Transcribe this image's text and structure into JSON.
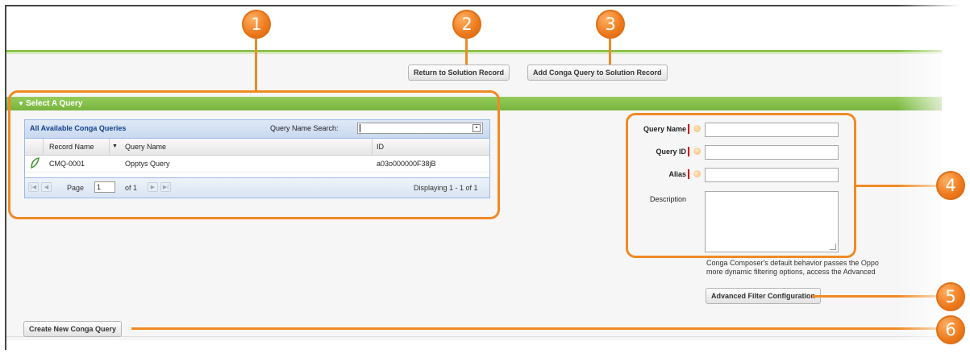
{
  "buttons": {
    "return_to_solution": "Return to Solution Record",
    "add_query_to_solution": "Add Conga Query to Solution Record",
    "advanced_filter": "Advanced Filter Configuration",
    "create_new_query": "Create New Conga Query"
  },
  "section": {
    "title": "Select A Query"
  },
  "grid": {
    "title": "All Available Conga Queries",
    "search_label": "Query Name Search:",
    "search_value": "",
    "columns": [
      "Record Name",
      "Query Name",
      "ID"
    ],
    "rows": [
      {
        "record_name": "CMQ-0001",
        "query_name": "Opptys Query",
        "id": "a03o000000F38jB"
      }
    ],
    "pager": {
      "page_label": "Page",
      "page_value": "1",
      "of_label": "of 1",
      "displaying": "Displaying 1 - 1 of 1"
    }
  },
  "form": {
    "query_name_label": "Query Name",
    "query_id_label": "Query ID",
    "alias_label": "Alias",
    "description_label": "Description",
    "query_name_value": "",
    "query_id_value": "",
    "alias_value": "",
    "description_value": ""
  },
  "help_text": {
    "line1": "Conga Composer's default behavior passes the Oppo",
    "line2": "more dynamic filtering options, access the Advanced"
  },
  "markers": [
    "1",
    "2",
    "3",
    "4",
    "5",
    "6"
  ],
  "colors": {
    "accent": "#f08a24",
    "section_green": "#80bb46",
    "grid_header_text": "#15428b",
    "required": "#cc0000"
  },
  "icons": [
    "sort-dropdown-icon",
    "record-leaf-icon",
    "search-trigger-icon",
    "first-page-icon",
    "prev-page-icon",
    "next-page-icon",
    "last-page-icon",
    "info-icon"
  ]
}
